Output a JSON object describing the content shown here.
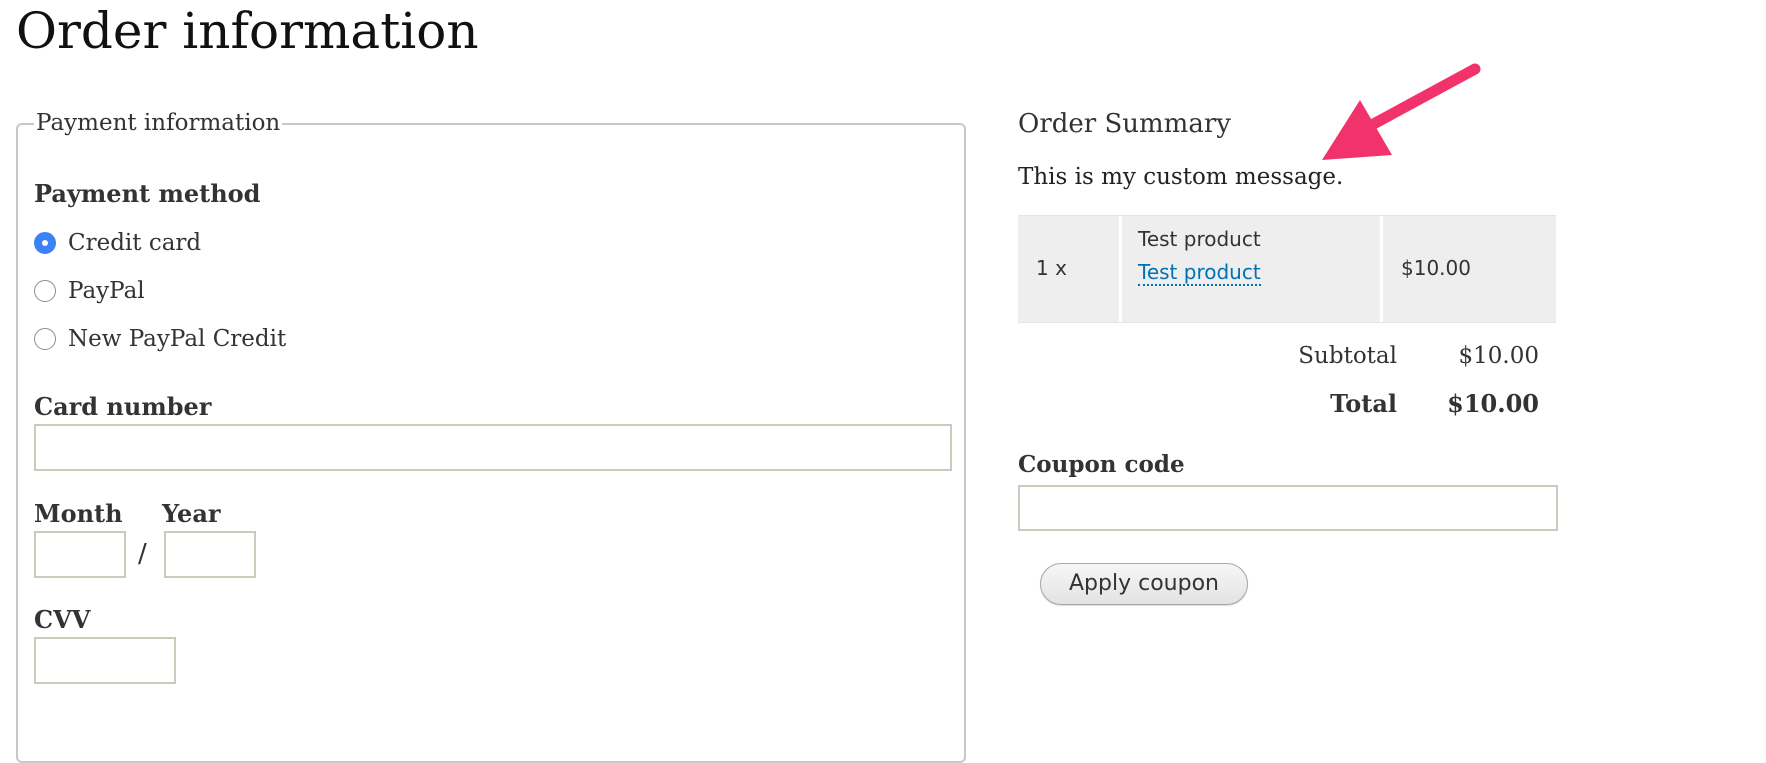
{
  "page": {
    "title": "Order information"
  },
  "payment": {
    "legend": "Payment information",
    "method_label": "Payment method",
    "methods": [
      {
        "label": "Credit card",
        "checked": true
      },
      {
        "label": "PayPal",
        "checked": false
      },
      {
        "label": "New PayPal Credit",
        "checked": false
      }
    ],
    "card_number_label": "Card number",
    "card_number_value": "",
    "month_label": "Month",
    "month_value": "",
    "date_separator": "/",
    "year_label": "Year",
    "year_value": "",
    "cvv_label": "CVV",
    "cvv_value": ""
  },
  "summary": {
    "title": "Order Summary",
    "message": "This is my custom message.",
    "items": [
      {
        "quantity": "1 x",
        "title": "Test product",
        "link_label": "Test product",
        "price": "$10.00"
      }
    ],
    "subtotal_label": "Subtotal",
    "subtotal_value": "$10.00",
    "total_label": "Total",
    "total_value": "$10.00"
  },
  "coupon": {
    "label": "Coupon code",
    "value": "",
    "apply_label": "Apply coupon"
  },
  "colors": {
    "accent_radio": "#3b82f6",
    "link": "#0071b3",
    "annotation_arrow": "#f2336b"
  }
}
